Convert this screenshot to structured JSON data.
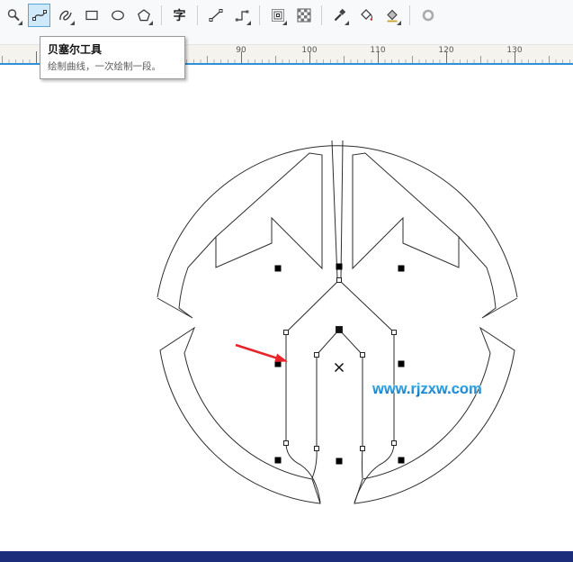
{
  "toolbar": {
    "selected_tool": "bezier",
    "text_tool_label": "字",
    "icons": [
      "zoom-tool",
      "bezier-tool",
      "artistic-media-tool",
      "rectangle-tool",
      "ellipse-tool",
      "polygon-tool",
      "text-tool",
      "line-tool",
      "connector-tool",
      "contour-tool",
      "pattern-tool",
      "eyedropper-tool",
      "smart-fill-tool",
      "fill-tool",
      "outline-tool"
    ]
  },
  "tooltip": {
    "title": "贝塞尔工具",
    "description": "绘制曲线，一次绘制一段。"
  },
  "ruler": {
    "labels": [
      "90",
      "100",
      "110",
      "120",
      "130"
    ]
  },
  "watermark": {
    "text": "www.rjzxw.com",
    "color_top": "#4ec1f5",
    "color_bottom": "#0a6cba"
  },
  "colors": {
    "accent_blue": "#2f8fd8",
    "tool_highlight": "#cfe9fb",
    "arrow_red": "#e8252a",
    "outline_black": "#2e2e2e",
    "bottom_bar_blue": "#1c2e7b"
  }
}
